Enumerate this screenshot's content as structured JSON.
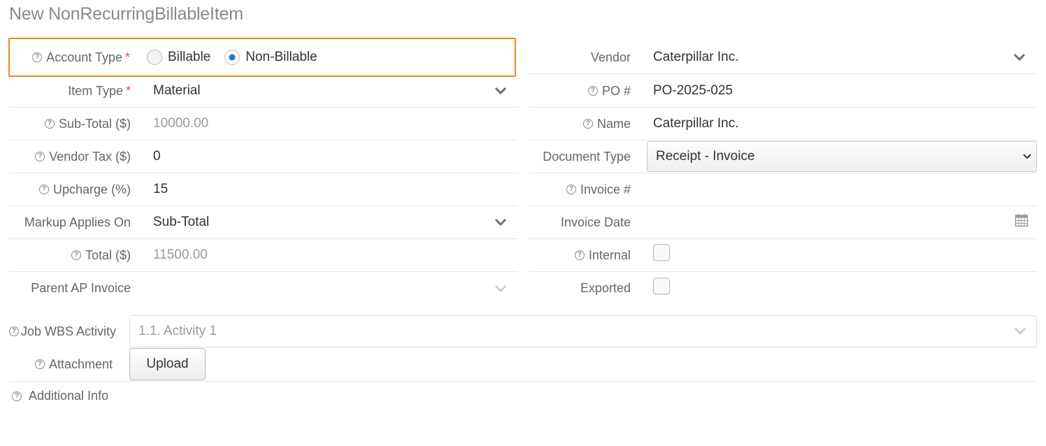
{
  "page": {
    "title": "New NonRecurringBillableItem"
  },
  "account_type": {
    "label": "Account Type",
    "required_mark": "*",
    "options": [
      {
        "label": "Billable",
        "checked": false
      },
      {
        "label": "Non-Billable",
        "checked": true
      }
    ]
  },
  "left_fields": {
    "item_type": {
      "label": "Item Type",
      "required_mark": "*",
      "value": "Material"
    },
    "sub_total": {
      "label": "Sub-Total ($)",
      "value": "10000.00"
    },
    "vendor_tax": {
      "label": "Vendor Tax ($)",
      "value": "0"
    },
    "upcharge": {
      "label": "Upcharge (%)",
      "value": "15"
    },
    "markup_applies_on": {
      "label": "Markup Applies On",
      "value": "Sub-Total"
    },
    "total": {
      "label": "Total ($)",
      "value": "11500.00"
    },
    "parent_ap_invoice": {
      "label": "Parent AP Invoice",
      "value": ""
    }
  },
  "right_fields": {
    "vendor": {
      "label": "Vendor",
      "value": "Caterpillar Inc."
    },
    "po_number": {
      "label": "PO #",
      "value": "PO-2025-025"
    },
    "name": {
      "label": "Name",
      "value": "Caterpillar Inc."
    },
    "document_type": {
      "label": "Document Type",
      "value": "Receipt - Invoice"
    },
    "invoice_number": {
      "label": "Invoice #",
      "value": ""
    },
    "invoice_date": {
      "label": "Invoice Date",
      "value": ""
    },
    "internal": {
      "label": "Internal",
      "checked": false
    },
    "exported": {
      "label": "Exported",
      "checked": false
    }
  },
  "job_wbs_activity": {
    "label": "Job WBS Activity",
    "value": "1.1. Activity 1"
  },
  "attachment": {
    "label": "Attachment",
    "button_label": "Upload"
  },
  "additional_info": {
    "label": "Additional Info"
  },
  "icons": {
    "help": "question-circle-icon",
    "dropdown": "chevron-down-icon",
    "calendar": "calendar-icon"
  },
  "colors": {
    "highlight_border": "#f08a1c",
    "required": "#d9534f",
    "radio_checked": "#1e7bd6",
    "label_text": "#666666",
    "muted_value": "#9a9a9a"
  }
}
